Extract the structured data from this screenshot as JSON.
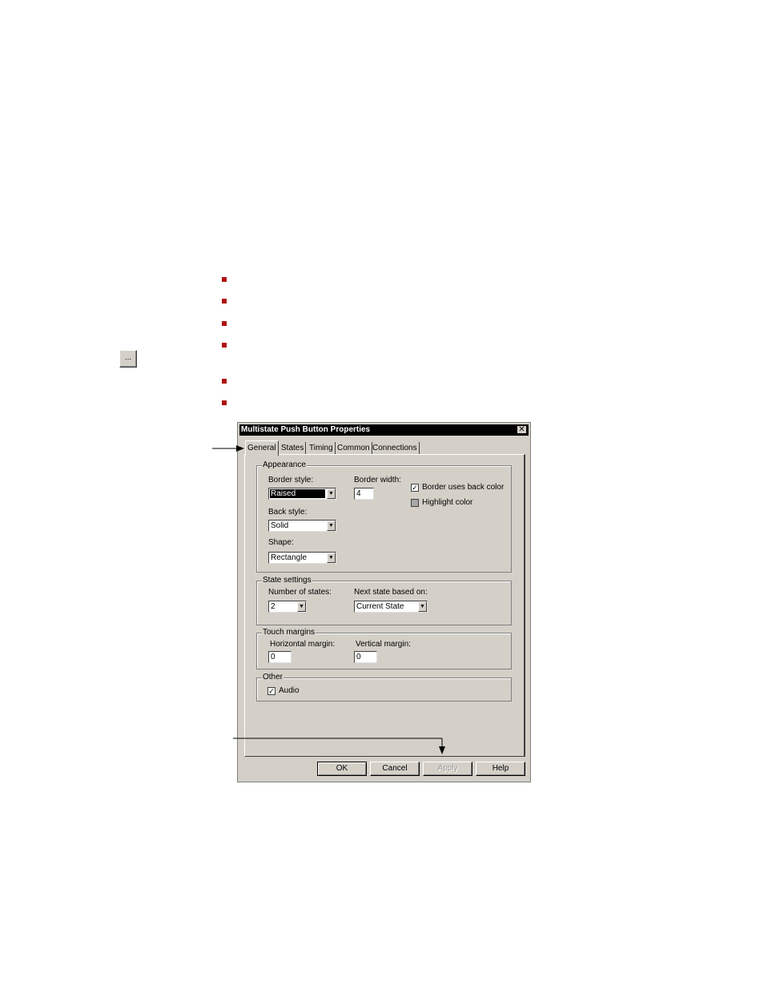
{
  "toolbar_button": {
    "label": "..."
  },
  "dialog": {
    "title": "Multistate Push Button Properties",
    "close_glyph": "✕",
    "tabs": [
      {
        "label": "General",
        "active": true
      },
      {
        "label": "States"
      },
      {
        "label": "Timing"
      },
      {
        "label": "Common"
      },
      {
        "label": "Connections"
      }
    ],
    "appearance": {
      "title": "Appearance",
      "border_style_label": "Border style:",
      "border_style_value": "Raised",
      "border_width_label": "Border width:",
      "border_width_value": "4",
      "back_style_label": "Back style:",
      "back_style_value": "Solid",
      "shape_label": "Shape:",
      "shape_value": "Rectangle",
      "border_uses_back_color_label": "Border uses back color",
      "border_uses_back_color_checked": true,
      "highlight_color_label": "Highlight color",
      "highlight_color_checked": false
    },
    "state_settings": {
      "title": "State settings",
      "number_of_states_label": "Number of states:",
      "number_of_states_value": "2",
      "next_state_label": "Next state based on:",
      "next_state_value": "Current State"
    },
    "touch_margins": {
      "title": "Touch margins",
      "horizontal_label": "Horizontal margin:",
      "horizontal_value": "0",
      "vertical_label": "Vertical margin:",
      "vertical_value": "0"
    },
    "other": {
      "title": "Other",
      "audio_label": "Audio",
      "audio_checked": true
    },
    "buttons": {
      "ok": "OK",
      "cancel": "Cancel",
      "apply": "Apply",
      "help": "Help"
    },
    "check_glyph": "✓",
    "dropdown_glyph": "▼"
  },
  "colors": {
    "bullet": "#b01010",
    "dialog_face": "#d4d0c8",
    "titlebar": "#000000"
  }
}
